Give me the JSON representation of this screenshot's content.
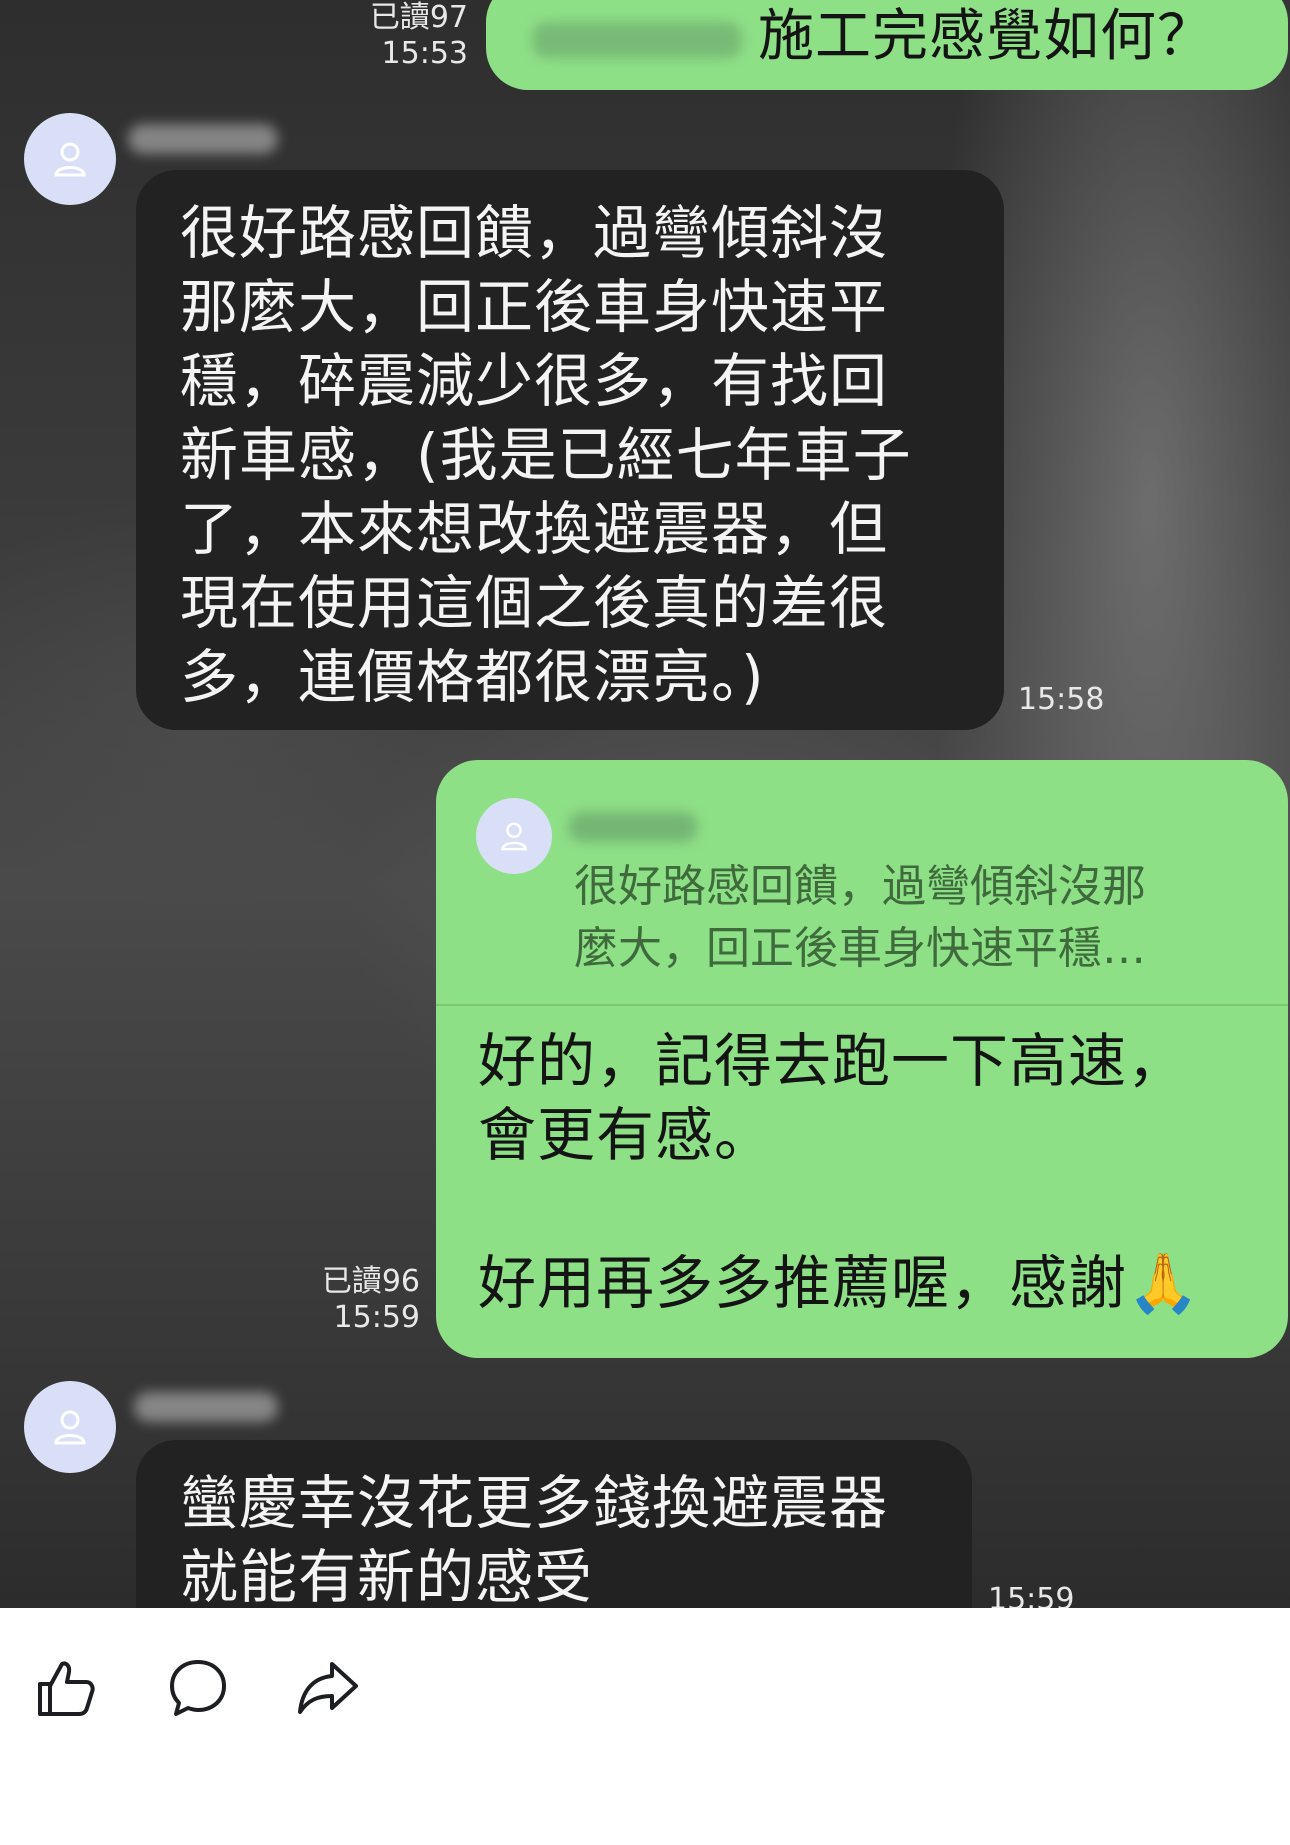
{
  "messages": {
    "m1": {
      "read_label": "已讀",
      "read_count": "97",
      "time": "15:53",
      "text": "施工完感覺如何？"
    },
    "m2": {
      "time": "15:58",
      "text": "很好路感回饋，過彎傾斜沒\n那麼大，回正後車身快速平\n穩，碎震減少很多，有找回\n新車感，(我是已經七年車子\n了，本來想改換避震器，但\n現在使用這個之後真的差很\n多，連價格都很漂亮。)"
    },
    "m3": {
      "read_label": "已讀",
      "read_count": "96",
      "time": "15:59",
      "quote": "很好路感回饋，過彎傾斜沒那\n麼大，回正後車身快速平穩…",
      "text": "好的，記得去跑一下高速，\n會更有感。\n\n好用再多多推薦喔，感謝🙏"
    },
    "m4": {
      "time": "15:59",
      "text": "蠻慶幸沒花更多錢換避震器\n就能有新的感受"
    }
  },
  "actions": {
    "like_icon": "thumbs-up-icon",
    "comment_icon": "comment-bubble-icon",
    "share_icon": "share-arrow-icon"
  },
  "colors": {
    "green_bubble": "#8ee087",
    "dark_bubble": "#222222",
    "avatar_bg": "#d9dff6"
  }
}
